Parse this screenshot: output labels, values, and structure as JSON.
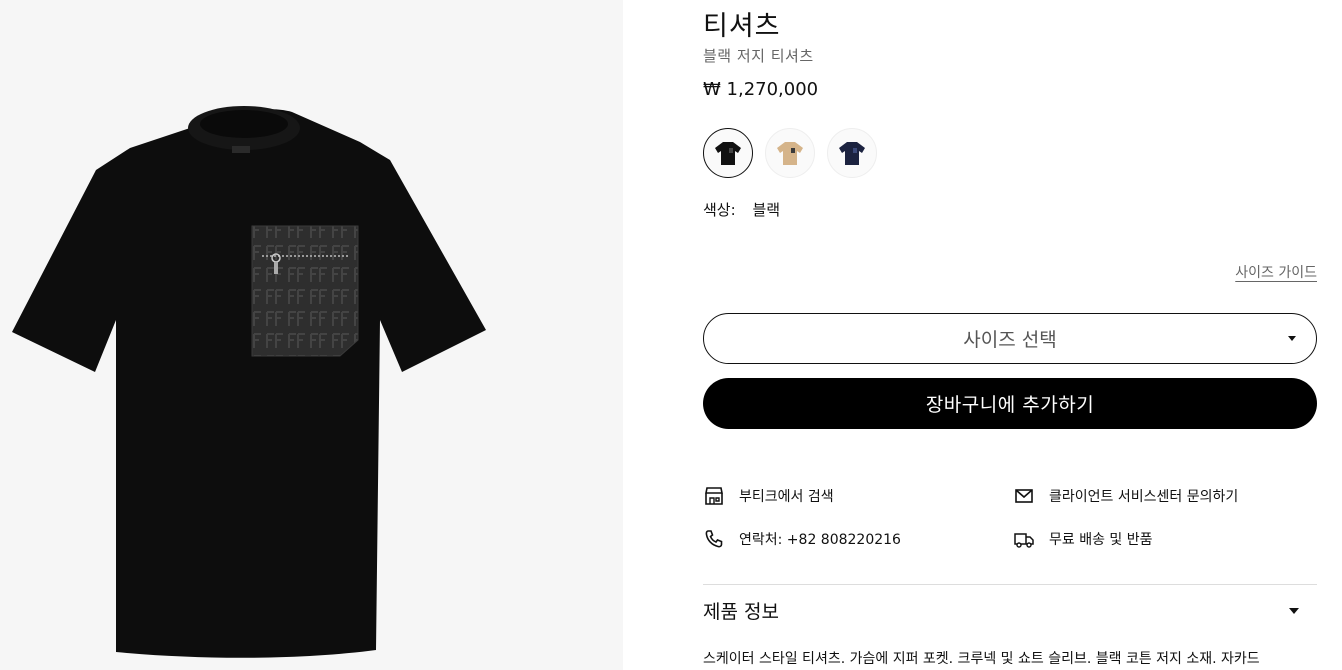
{
  "product": {
    "title": "티셔츠",
    "subtitle": "블랙 저지 티셔츠",
    "price": "₩ 1,270,000",
    "color_label": "색상:",
    "color_value": "블랙",
    "description": "스케이터 스타일 티셔츠. 가슴에 지퍼 포켓. 크루넥 및 쇼트 슬리브. 블랙 코튼 저지 소재. 자카드"
  },
  "swatches": [
    {
      "name": "black",
      "color": "#111111",
      "selected": true
    },
    {
      "name": "beige",
      "color": "#d5b48a",
      "selected": false
    },
    {
      "name": "navy",
      "color": "#1c2340",
      "selected": false
    }
  ],
  "size": {
    "guide_label": "사이즈 가이드",
    "select_label": "사이즈 선택"
  },
  "cart": {
    "add_label": "장바구니에 추가하기"
  },
  "services": {
    "boutique": "부티크에서 검색",
    "client_service": "클라이언트 서비스센터 문의하기",
    "phone": "연락처: +82 808220216",
    "shipping": "무료 배송 및 반품"
  },
  "accordion": {
    "product_info": "제품 정보"
  },
  "icons": {
    "boutique": "store-icon",
    "mail": "mail-icon",
    "phone": "phone-icon",
    "shipping": "truck-icon",
    "dropdown": "chevron-down-icon"
  },
  "colors": {
    "gallery_bg": "#f6f6f6",
    "button_bg": "#000000",
    "muted_text": "#666666"
  }
}
